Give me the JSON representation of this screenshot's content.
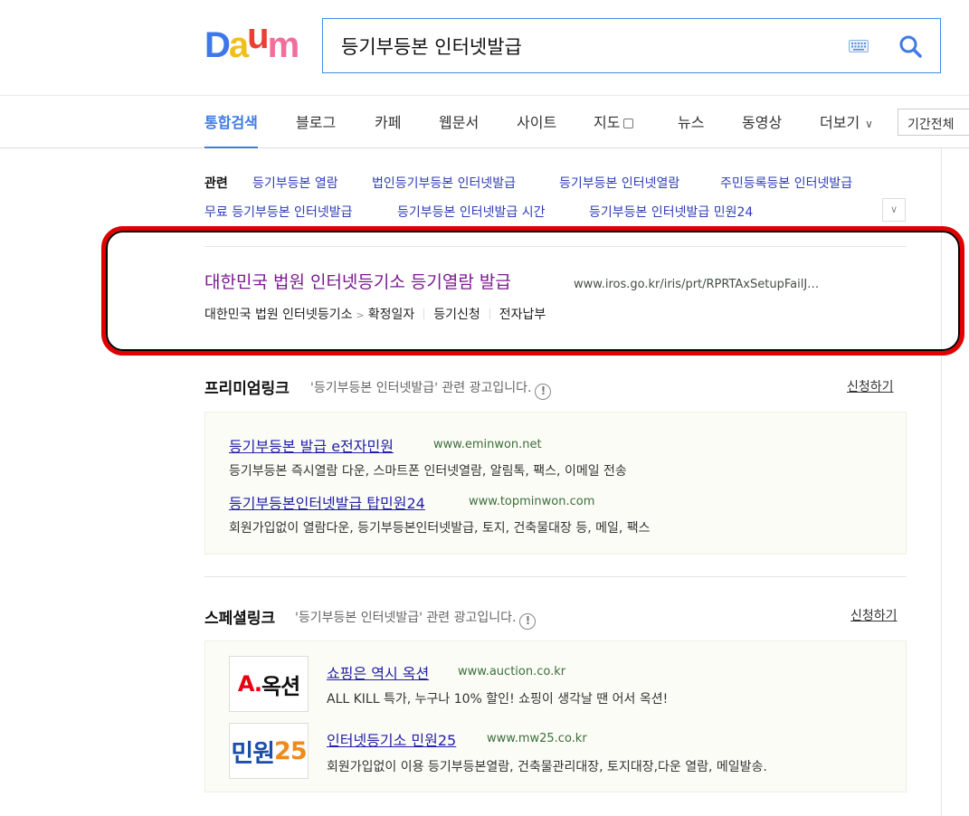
{
  "logo": {
    "letters": [
      "D",
      "a",
      "u",
      "m"
    ],
    "colors": [
      "#3d77e8",
      "#f1bf1c",
      "#e84133",
      "#f26f9b"
    ]
  },
  "search": {
    "query": "등기부등본 인터넷발급"
  },
  "tabs": [
    "통합검색",
    "블로그",
    "카페",
    "웹문서",
    "사이트",
    "지도",
    "뉴스",
    "동영상",
    "더보기"
  ],
  "period_select": "기간전체",
  "related": {
    "label": "관련",
    "items": [
      "등기부등본 열람",
      "법인등기부등본 인터넷발급",
      "등기부등본 인터넷열람",
      "주민등록등본 인터넷발급",
      "무료 등기부등본 인터넷발급",
      "등기부등본 인터넷발급 시간",
      "등기부등본 인터넷발급 민원24"
    ]
  },
  "top_result": {
    "title": "대한민국 법원 인터넷등기소 등기열람 발급",
    "url": "www.iros.go.kr/iris/prt/RPRTAxSetupFailJ…",
    "breadcrumb_site": "대한민국 법원 인터넷등기소",
    "breadcrumb_page": "확정일자",
    "links": [
      "등기신청",
      "전자납부"
    ]
  },
  "premium": {
    "title": "프리미엄링크",
    "subtitle": "'등기부등본 인터넷발급' 관련 광고입니다.",
    "apply": "신청하기",
    "ads": [
      {
        "title": "등기부등본 발급 e전자민원",
        "url": "www.eminwon.net",
        "desc": "등기부등본 즉시열람 다운, 스마트폰 인터넷열람, 알림톡, 팩스, 이메일 전송"
      },
      {
        "title": "등기부등본인터넷발급 탑민원24",
        "url": "www.topminwon.com",
        "desc": "회원가입없이 열람다운, 등기부등본인터넷발급, 토지, 건축물대장 등, 메일, 팩스"
      }
    ]
  },
  "special": {
    "title": "스페셜링크",
    "subtitle": "'등기부등본 인터넷발급' 관련 광고입니다.",
    "apply": "신청하기",
    "ads": [
      {
        "title": "쇼핑은 역시 옥션",
        "url": "www.auction.co.kr",
        "desc": "ALL KILL 특가, 누구나 10% 할인! 쇼핑이 생각날 땐 어서 옥션!",
        "thumb_a": "A.",
        "thumb_b": "옥션"
      },
      {
        "title": "인터넷등기소 민원25",
        "url": "www.mw25.co.kr",
        "desc": "회원가입없이 이용 등기부등본열람, 건축물관리대장, 토지대장,다운 열람, 메일발송.",
        "thumb_a": "민원",
        "thumb_b": "25"
      }
    ]
  },
  "colors": {
    "accent": "#3e7be3",
    "visited_title": "#7a1a8f",
    "ad_link": "#2220a8",
    "highlight_border": "#e00000"
  }
}
